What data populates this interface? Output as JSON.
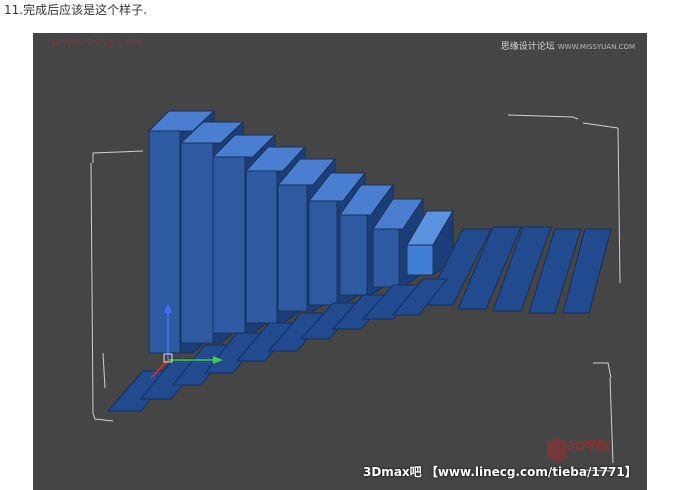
{
  "caption": "11.完成后应该是这个样子.",
  "viewport": {
    "watermark_left": "WWW.9SSJ.COM",
    "watermark_right": "思缘设计论坛",
    "watermark_right_sub": "WWW.MISSYUAN.COM",
    "bottom_watermark": "3Dmax吧 【www.linecg.com/tieba/1771】",
    "logo_watermark": "3D学院"
  },
  "colors": {
    "viewport_bg": "#454545",
    "box_front": "#2d5aa0",
    "box_top": "#4a7ed0",
    "box_side": "#1c3e78",
    "panel": "#214a8f",
    "highlight": "#3f7fd4",
    "frame": "#d0d0d0"
  }
}
